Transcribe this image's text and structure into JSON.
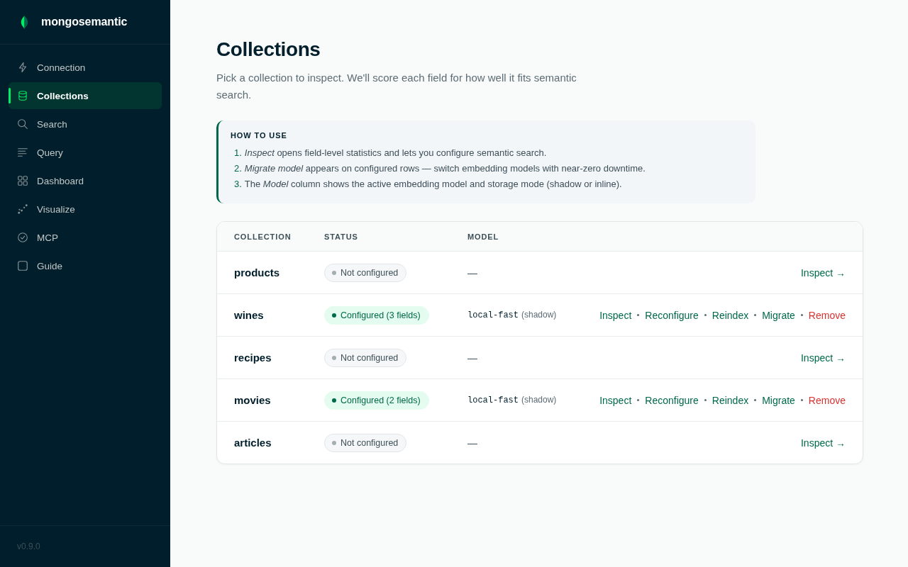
{
  "sidebar": {
    "brand": "mongosemantic",
    "items": [
      {
        "label": "Connection",
        "selected": false
      },
      {
        "label": "Collections",
        "selected": true
      },
      {
        "label": "Search",
        "selected": false
      },
      {
        "label": "Query",
        "selected": false
      },
      {
        "label": "Dashboard",
        "selected": false
      },
      {
        "label": "Visualize",
        "selected": false
      },
      {
        "label": "MCP",
        "selected": false
      },
      {
        "label": "Guide",
        "selected": false
      }
    ],
    "version": "v0.9.0"
  },
  "page": {
    "title": "Collections",
    "description": "Pick a collection to inspect. We'll score each field for how well it fits semantic search."
  },
  "how_to": {
    "title": "HOW TO USE",
    "steps": [
      {
        "number": "1.",
        "text": "*Inspect* opens field-level statistics and lets you configure semantic search."
      },
      {
        "number": "2.",
        "text": "*Migrate model* appears on configured rows — switch embedding models with near-zero downtime."
      },
      {
        "number": "3.",
        "text": "The *Model* column shows the active embedding model and storage mode (shadow or inline)."
      }
    ]
  },
  "table": {
    "columns": [
      "COLLECTION",
      "STATUS",
      "MODEL"
    ],
    "rows": [
      {
        "name": "products",
        "configured": false,
        "status": "Not configured",
        "model": "—",
        "actions": [
          {
            "label": "Inspect →",
            "kind": "link"
          }
        ]
      },
      {
        "name": "wines",
        "configured": true,
        "status": "Configured (3 fields)",
        "model": "local-fast",
        "storage": "(shadow)",
        "actions": [
          {
            "label": "Inspect",
            "kind": "link"
          },
          {
            "label": "Reconfigure",
            "kind": "link"
          },
          {
            "label": "Reindex",
            "kind": "link"
          },
          {
            "label": "Migrate",
            "kind": "link"
          },
          {
            "label": "Remove",
            "kind": "danger"
          }
        ]
      },
      {
        "name": "recipes",
        "configured": false,
        "status": "Not configured",
        "model": "—",
        "actions": [
          {
            "label": "Inspect →",
            "kind": "link"
          }
        ]
      },
      {
        "name": "movies",
        "configured": true,
        "status": "Configured (2 fields)",
        "model": "local-fast",
        "storage": "(shadow)",
        "actions": [
          {
            "label": "Inspect",
            "kind": "link"
          },
          {
            "label": "Reconfigure",
            "kind": "link"
          },
          {
            "label": "Reindex",
            "kind": "link"
          },
          {
            "label": "Migrate",
            "kind": "link"
          },
          {
            "label": "Remove",
            "kind": "danger"
          }
        ]
      },
      {
        "name": "articles",
        "configured": false,
        "status": "Not configured",
        "model": "—",
        "actions": [
          {
            "label": "Inspect →",
            "kind": "link"
          }
        ]
      }
    ]
  }
}
